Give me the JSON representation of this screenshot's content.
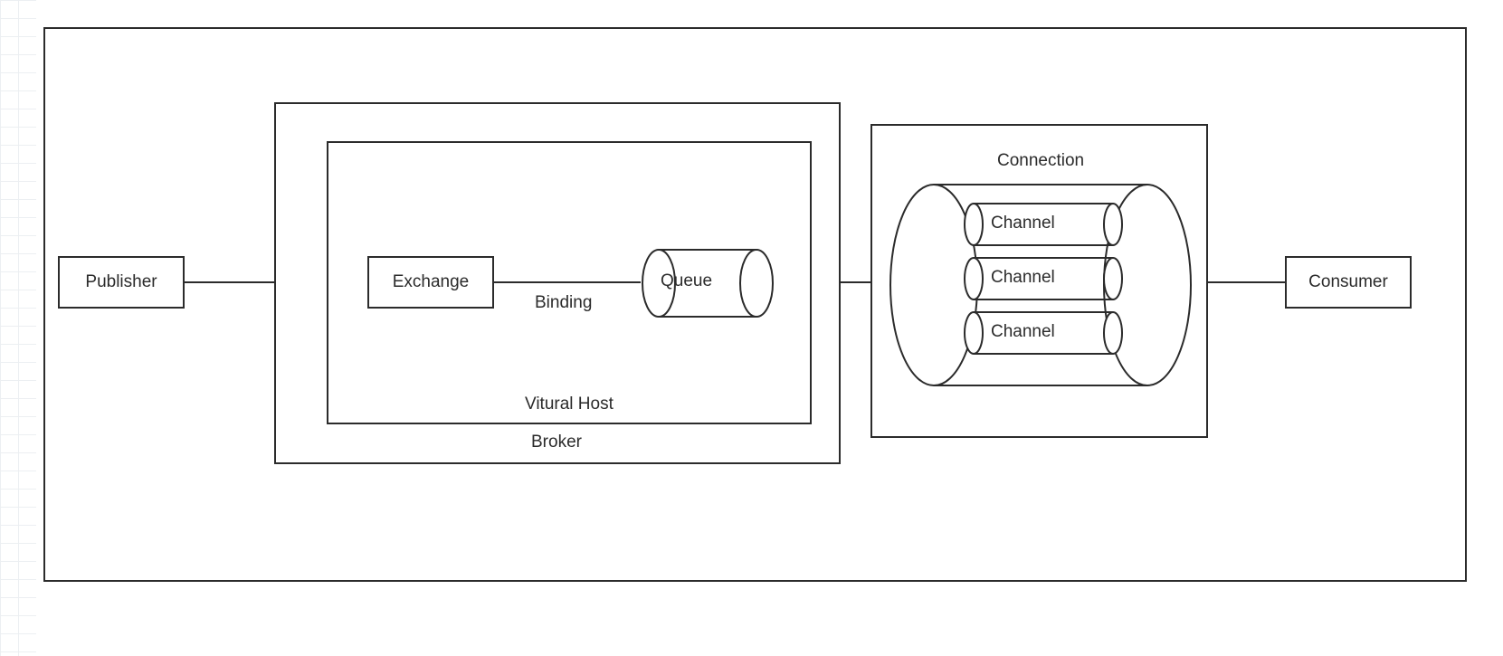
{
  "nodes": {
    "publisher": "Publisher",
    "exchange": "Exchange",
    "binding": "Binding",
    "queue": "Queue",
    "virtual_host": "Vitural Host",
    "broker": "Broker",
    "connection": "Connection",
    "channels": [
      "Channel",
      "Channel",
      "Channel"
    ],
    "consumer": "Consumer"
  }
}
